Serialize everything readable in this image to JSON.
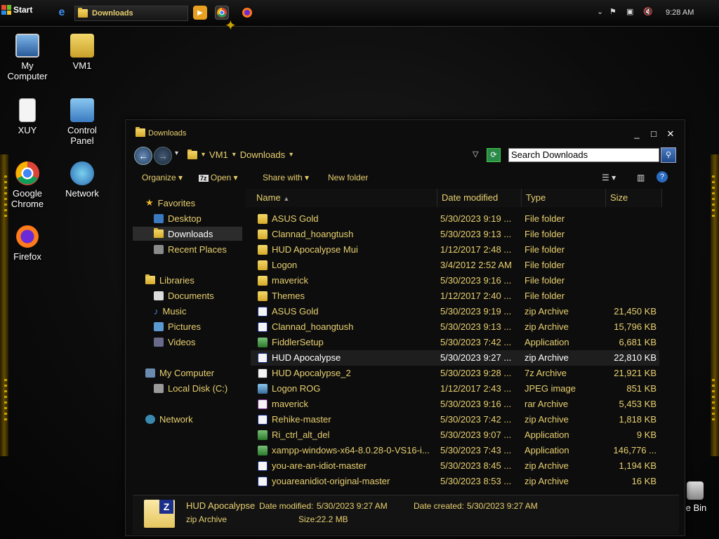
{
  "taskbar": {
    "start_label": "Start",
    "task_label": "Downloads",
    "clock": "9:28 AM"
  },
  "desktop": {
    "icons": [
      {
        "label": "My Computer",
        "icon": "computer-icon"
      },
      {
        "label": "VM1",
        "icon": "user-folder-icon"
      },
      {
        "label": "XUY",
        "icon": "document-icon"
      },
      {
        "label": "Control Panel",
        "icon": "control-panel-icon"
      },
      {
        "label": "Google Chrome",
        "icon": "chrome-icon"
      },
      {
        "label": "Network",
        "icon": "network-icon"
      },
      {
        "label": "Firefox",
        "icon": "firefox-icon"
      },
      {
        "label": "le Bin",
        "icon": "recycle-bin-icon"
      }
    ]
  },
  "window": {
    "title": "Downloads",
    "breadcrumb": [
      "VM1",
      "Downloads"
    ],
    "search_placeholder": "Search Downloads",
    "toolbar": {
      "organize": "Organize",
      "open": "Open",
      "share_with": "Share with",
      "new_folder": "New folder"
    },
    "nav": {
      "favorites": "Favorites",
      "desktop": "Desktop",
      "downloads": "Downloads",
      "recent_places": "Recent Places",
      "libraries": "Libraries",
      "documents": "Documents",
      "music": "Music",
      "pictures": "Pictures",
      "videos": "Videos",
      "my_computer": "My Computer",
      "local_disk": "Local Disk (C:)",
      "network": "Network"
    },
    "columns": {
      "name": "Name",
      "date": "Date modified",
      "type": "Type",
      "size": "Size"
    },
    "files": [
      {
        "name": "ASUS Gold",
        "date": "5/30/2023 9:19 ...",
        "type": "File folder",
        "size": "",
        "icon": "folder-icon"
      },
      {
        "name": "Clannad_hoangtush",
        "date": "5/30/2023 9:13 ...",
        "type": "File folder",
        "size": "",
        "icon": "folder-icon"
      },
      {
        "name": "HUD Apocalypse Mui",
        "date": "1/12/2017 2:48 ...",
        "type": "File folder",
        "size": "",
        "icon": "folder-icon"
      },
      {
        "name": "Logon",
        "date": "3/4/2012 2:52 AM",
        "type": "File folder",
        "size": "",
        "icon": "folder-icon"
      },
      {
        "name": "maverick",
        "date": "5/30/2023 9:16 ...",
        "type": "File folder",
        "size": "",
        "icon": "folder-icon"
      },
      {
        "name": "Themes",
        "date": "1/12/2017 2:40 ...",
        "type": "File folder",
        "size": "",
        "icon": "folder-icon"
      },
      {
        "name": "ASUS Gold",
        "date": "5/30/2023 9:19 ...",
        "type": "zip Archive",
        "size": "21,450 KB",
        "icon": "zip-icon"
      },
      {
        "name": "Clannad_hoangtush",
        "date": "5/30/2023 9:13 ...",
        "type": "zip Archive",
        "size": "15,796 KB",
        "icon": "zip-icon"
      },
      {
        "name": "FiddlerSetup",
        "date": "5/30/2023 7:42 ...",
        "type": "Application",
        "size": "6,681 KB",
        "icon": "app-icon"
      },
      {
        "name": "HUD Apocalypse",
        "date": "5/30/2023 9:27 ...",
        "type": "zip Archive",
        "size": "22,810 KB",
        "icon": "zip-icon",
        "selected": true
      },
      {
        "name": "HUD Apocalypse_2",
        "date": "5/30/2023 9:28 ...",
        "type": "7z Archive",
        "size": "21,921 KB",
        "icon": "7z-icon"
      },
      {
        "name": "Logon ROG",
        "date": "1/12/2017 2:43 ...",
        "type": "JPEG image",
        "size": "851 KB",
        "icon": "image-icon"
      },
      {
        "name": "maverick",
        "date": "5/30/2023 9:16 ...",
        "type": "rar Archive",
        "size": "5,453 KB",
        "icon": "rar-icon"
      },
      {
        "name": "Rehike-master",
        "date": "5/30/2023 7:42 ...",
        "type": "zip Archive",
        "size": "1,818 KB",
        "icon": "zip-icon"
      },
      {
        "name": "Ri_ctrl_alt_del",
        "date": "5/30/2023 9:07 ...",
        "type": "Application",
        "size": "9 KB",
        "icon": "app-icon"
      },
      {
        "name": "xampp-windows-x64-8.0.28-0-VS16-i...",
        "date": "5/30/2023 7:43 ...",
        "type": "Application",
        "size": "146,776 ...",
        "icon": "app-icon"
      },
      {
        "name": "you-are-an-idiot-master",
        "date": "5/30/2023 8:45 ...",
        "type": "zip Archive",
        "size": "1,194 KB",
        "icon": "zip-icon"
      },
      {
        "name": "youareanidiot-original-master",
        "date": "5/30/2023 8:53 ...",
        "type": "zip Archive",
        "size": "16 KB",
        "icon": "zip-icon"
      }
    ],
    "details": {
      "name": "HUD Apocalypse",
      "type": "zip Archive",
      "date_modified_label": "Date modified:",
      "date_modified": "5/30/2023 9:27 AM",
      "date_created_label": "Date created:",
      "date_created": "5/30/2023 9:27 AM",
      "size_label": "Size:",
      "size": "22.2 MB"
    }
  },
  "colors": {
    "text_gold": "#e8d070",
    "selection": "#1e1e1e",
    "folder": "#f3d86a"
  }
}
